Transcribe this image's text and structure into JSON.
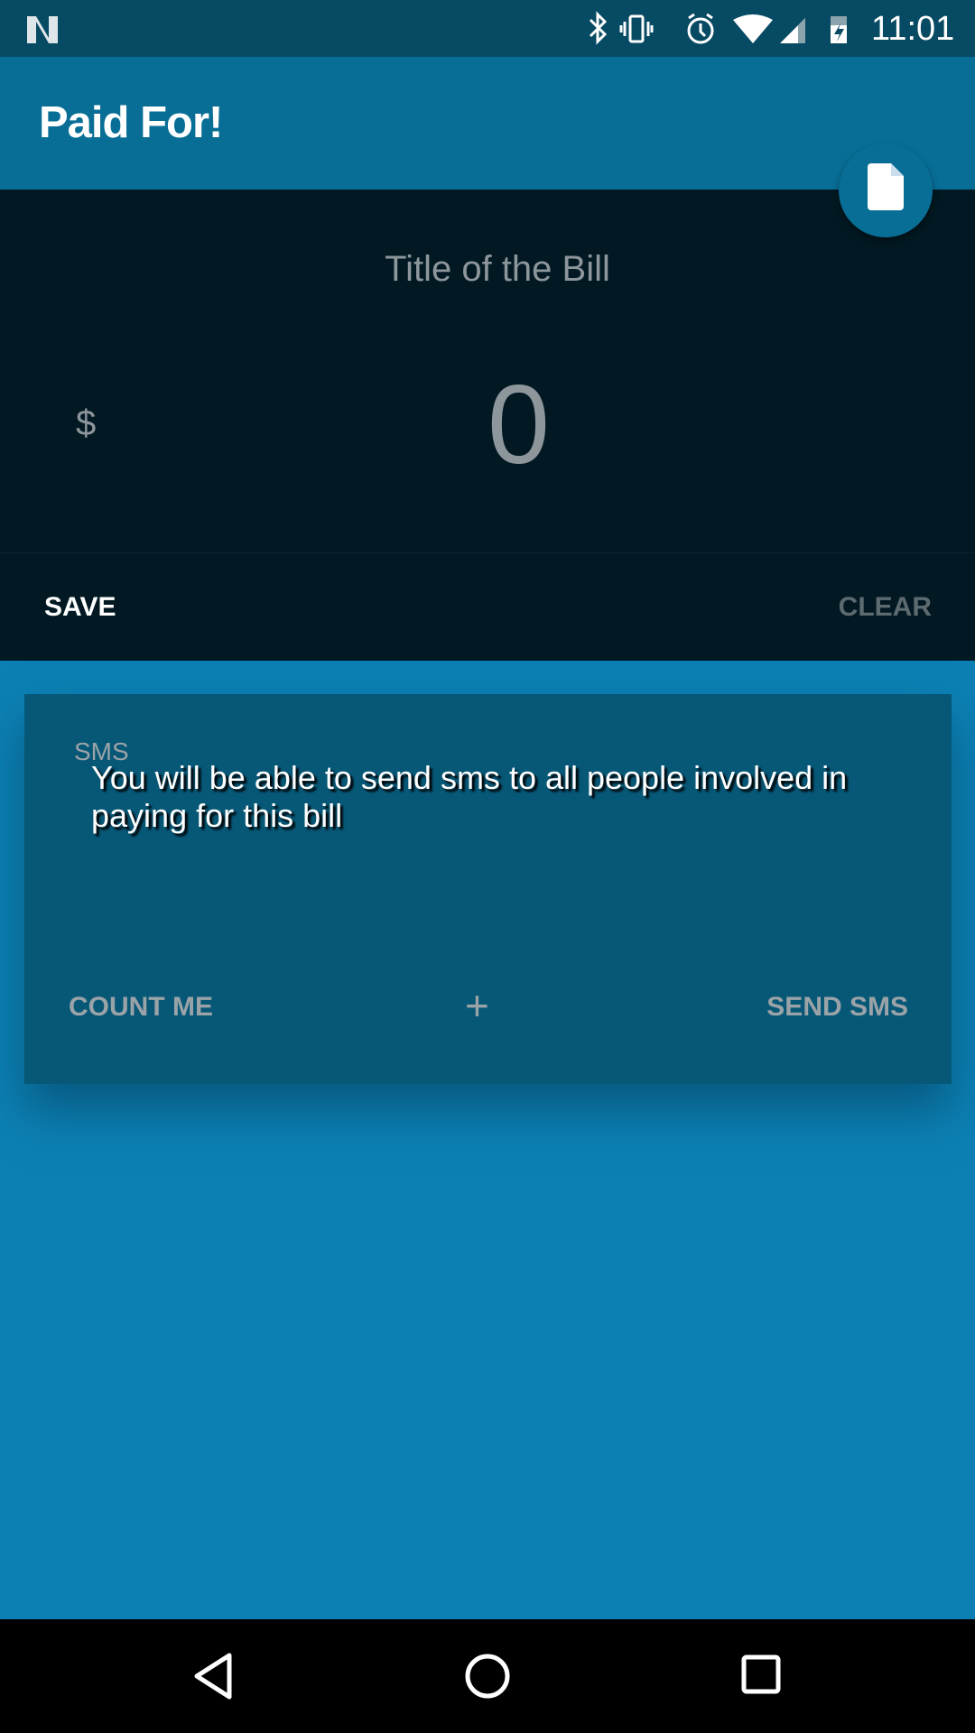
{
  "status_bar": {
    "time": "11:01",
    "icons": [
      "n-logo-icon",
      "bluetooth-icon",
      "vibrate-icon",
      "alarm-icon",
      "wifi-icon",
      "signal-icon",
      "battery-charging-icon"
    ]
  },
  "app_bar": {
    "title": "Paid For!",
    "fab_icon": "document-icon"
  },
  "bill": {
    "title_placeholder": "Title of the Bill",
    "currency": "$",
    "amount": "0"
  },
  "actions": {
    "save": "SAVE",
    "clear": "CLEAR"
  },
  "sms_card": {
    "label": "SMS",
    "message": "You will be able to send sms to all people involved in paying for this bill",
    "count_me": "COUNT ME",
    "add": "+",
    "send_sms": "SEND SMS"
  },
  "colors": {
    "status_bar": "#074a63",
    "app_bar": "#086e96",
    "dark_panel": "#021923",
    "background": "#0c80b4",
    "card": "#075776"
  }
}
